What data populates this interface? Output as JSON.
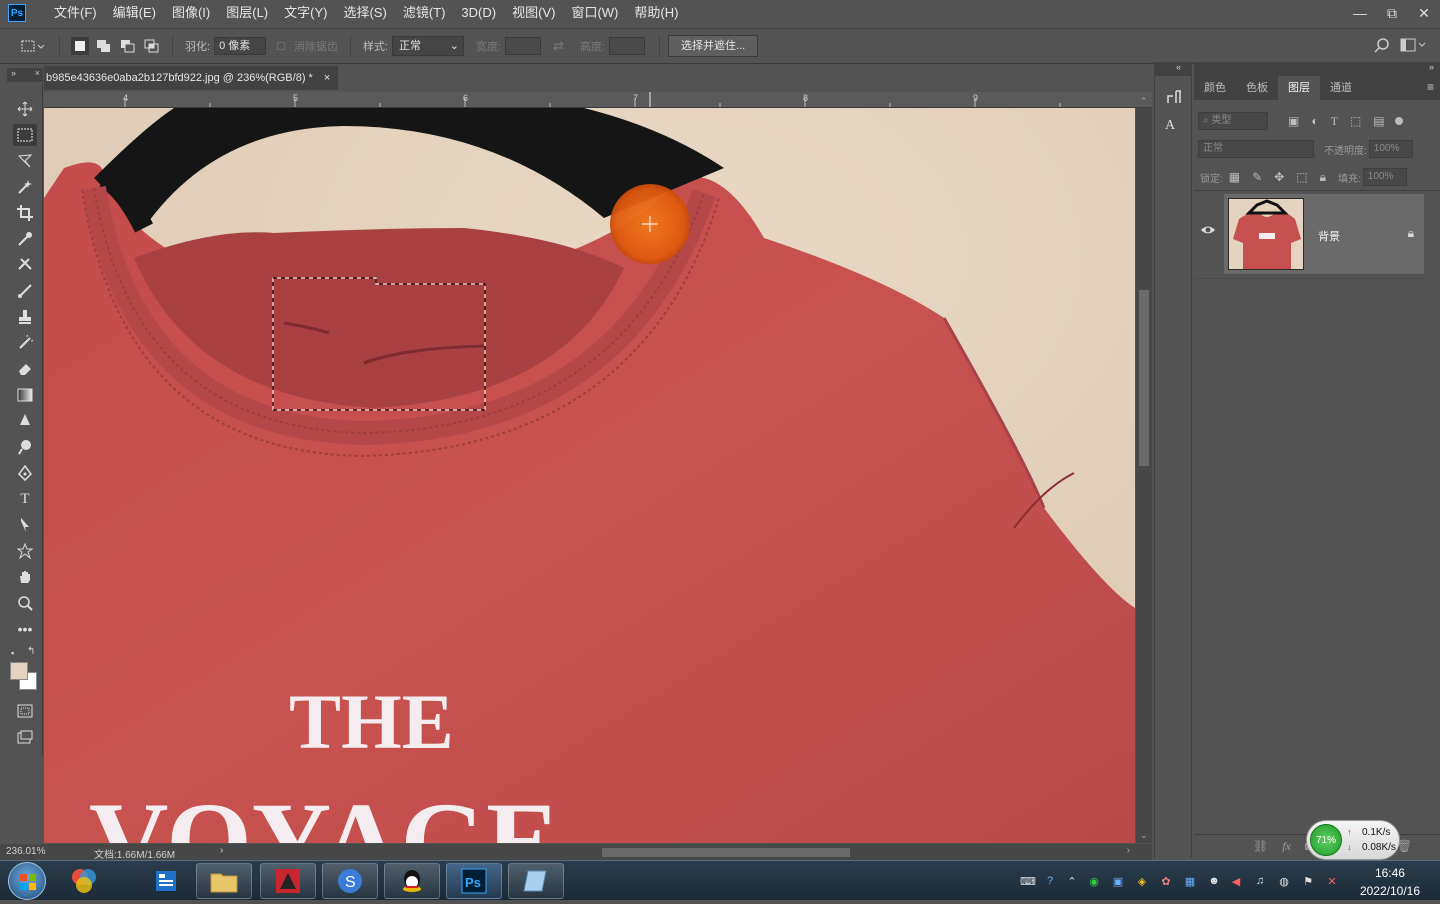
{
  "app": {
    "logo": "Ps"
  },
  "menu": [
    "文件(F)",
    "编辑(E)",
    "图像(I)",
    "图层(L)",
    "文字(Y)",
    "选择(S)",
    "滤镜(T)",
    "3D(D)",
    "视图(V)",
    "窗口(W)",
    "帮助(H)"
  ],
  "window_controls": {
    "minimize": "—",
    "restore": "⧉",
    "close": "✕"
  },
  "options": {
    "feather_label": "羽化:",
    "feather_value": "0 像素",
    "antialias_label": "消除锯齿",
    "style_label": "样式:",
    "style_value": "正常",
    "width_label": "宽度:",
    "height_label": "高度:",
    "select_mask_button": "选择并遮住..."
  },
  "document": {
    "tab_title": "b985e43636e0aba2b127bfd922.jpg @ 236%(RGB/8) *",
    "close": "×",
    "ruler_labels": [
      "4",
      "5",
      "6",
      "7",
      "8",
      "9"
    ],
    "canvas_text_line1": "THE",
    "canvas_text_line2": "VOYAGE"
  },
  "status": {
    "zoom": "236.01%",
    "doc_info": "文档:1.66M/1.66M"
  },
  "panels": {
    "tabs": [
      "颜色",
      "色板",
      "图层",
      "通道"
    ],
    "active_tab": "图层",
    "filter_placeholder": "类型",
    "blend_mode": "正常",
    "opacity_label": "不透明度:",
    "opacity_value": "100%",
    "lock_label": "锁定:",
    "fill_label": "填充:",
    "fill_value": "100%",
    "layers": [
      {
        "name": "背景",
        "visible": true,
        "locked": true
      }
    ]
  },
  "netwidget": {
    "percent": "71%",
    "up": "0.1K/s",
    "down": "0.08K/s"
  },
  "taskbar": {
    "time": "16:46",
    "date": "2022/10/16"
  },
  "colors": {
    "accent": "#31a8ff",
    "shirt": "#c5504f",
    "background": "#e4d3bf",
    "hanger": "#151515",
    "cursor_dot": "#e05a10"
  }
}
